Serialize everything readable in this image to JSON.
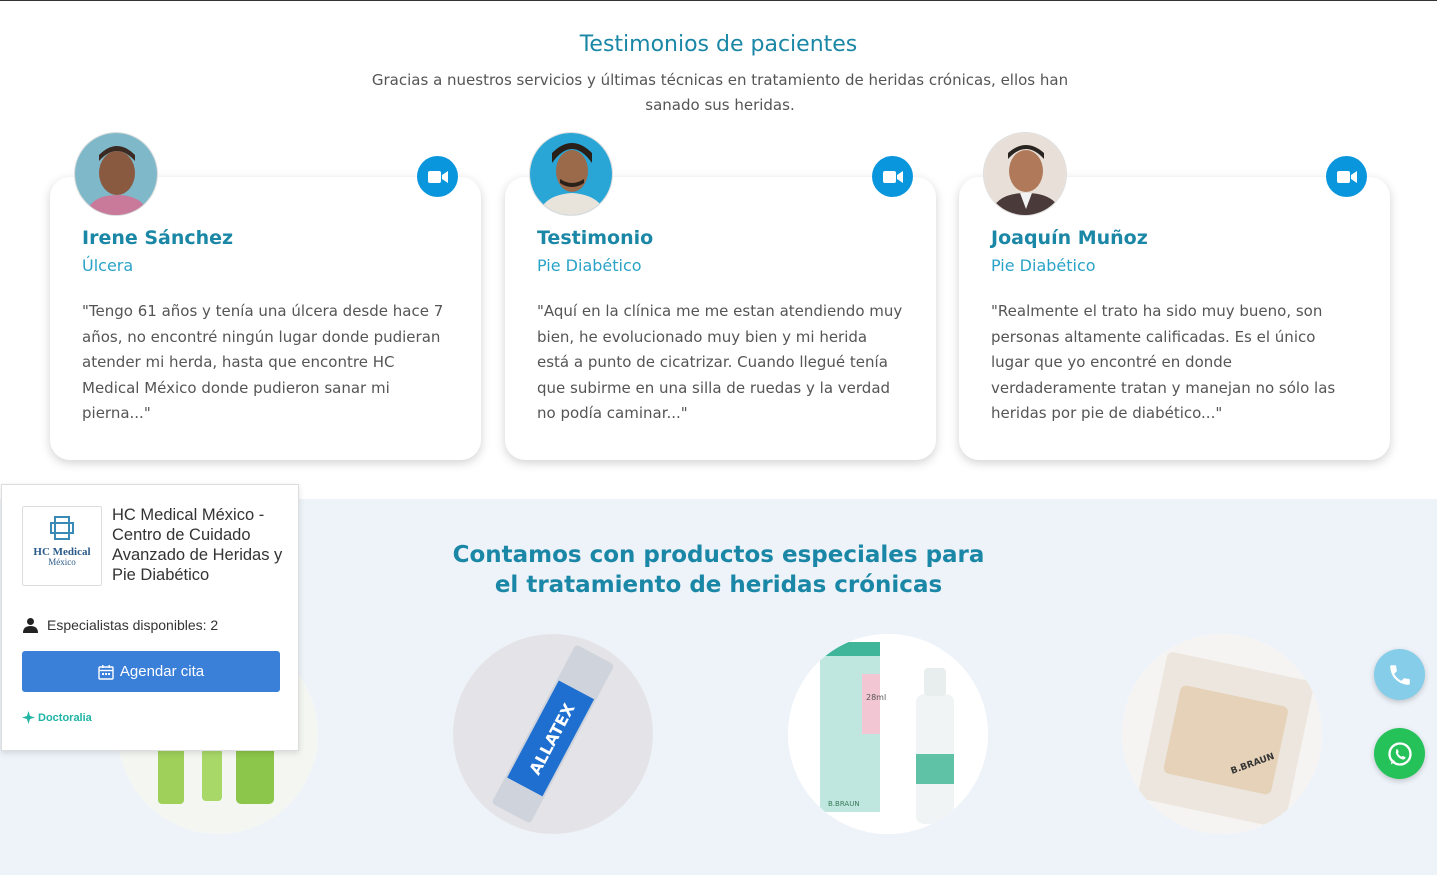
{
  "testimonials": {
    "title": "Testimonios de pacientes",
    "subtitle": "Gracias a nuestros servicios y últimas técnicas en tratamiento de heridas crónicas, ellos han sanado sus heridas.",
    "cards": [
      {
        "name": "Irene Sánchez",
        "condition": "Úlcera",
        "quote": "\"Tengo 61 años y tenía una úlcera desde hace 7 años, no encontré ningún lugar donde pudieran atender mi herda, hasta que encontre HC Medical México donde pudieron sanar mi pierna...\""
      },
      {
        "name": "Testimonio",
        "condition": "Pie Diabético",
        "quote": "\"Aquí en la clínica me me estan atendiendo muy bien, he evolucionado muy bien y mi herida está a punto de cicatrizar. Cuando llegué tenía que subirme en una silla de ruedas y la verdad no podía caminar...\""
      },
      {
        "name": "Joaquín Muñoz",
        "condition": "Pie Diabético",
        "quote": "\"Realmente el trato ha sido muy bueno, son personas altamente calificadas. Es el único lugar que yo encontré en donde verdaderamente tratan y manejan no sólo las heridas por pie de diabético...\""
      }
    ]
  },
  "products": {
    "title_line1": "Contamos con productos especiales para",
    "title_line2": "el tratamiento de heridas crónicas",
    "items": [
      {
        "label_1": "ALLATEX",
        "label_2": ""
      },
      {
        "label_1": "28ml",
        "label_2": "B.BRAUN"
      },
      {
        "label_1": "B.BRAUN",
        "label_2": ""
      }
    ]
  },
  "widget": {
    "logo_line1": "HC Medical",
    "logo_line2": "México",
    "clinic_name": "HC Medical México - Centro de Cuidado Avanzado de Heridas y Pie Diabético",
    "specialists": "Especialistas disponibles: 2",
    "book_label": "Agendar cita",
    "brand": "Doctoralia"
  },
  "floating": {
    "phone_icon": "phone-icon",
    "whatsapp_icon": "whatsapp-icon"
  },
  "colors": {
    "accent": "#1b87a6",
    "video_button": "#0a96dc",
    "products_bg": "#edf3f9",
    "book_button": "#3a7fd8",
    "whatsapp": "#25c25a",
    "phone": "#86cdea"
  }
}
